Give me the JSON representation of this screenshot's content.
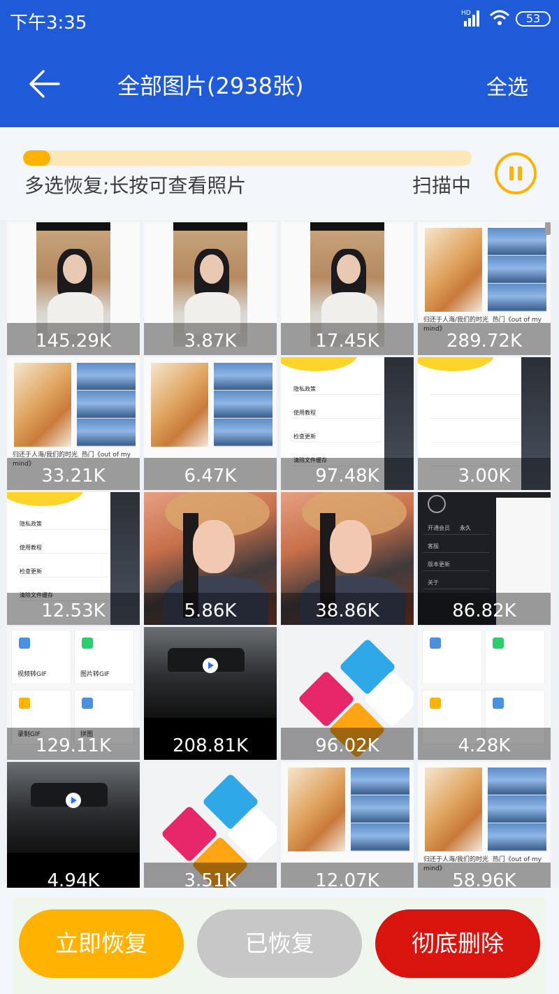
{
  "status_bar": {
    "time": "下午3:35",
    "network": "HD",
    "battery": "53"
  },
  "header": {
    "title": "全部图片(2938张)",
    "select_all": "全选"
  },
  "scan": {
    "progress_fraction": 0.06,
    "hint": "多选恢复;长按可查看照片",
    "status": "扫描中"
  },
  "thumbnails": [
    {
      "size": "145.29K",
      "kind": "portrait"
    },
    {
      "size": "3.87K",
      "kind": "portrait"
    },
    {
      "size": "17.45K",
      "kind": "portrait"
    },
    {
      "size": "289.72K",
      "kind": "collage",
      "caption_left": "归还于人海/我们的时光",
      "caption_right": "热门《out of my mind》"
    },
    {
      "size": "33.21K",
      "kind": "collage",
      "caption_left": "归还于人海/我们的时光",
      "caption_right": "热门《out of my mind》"
    },
    {
      "size": "6.47K",
      "kind": "collage",
      "caption_left": "",
      "caption_right": ""
    },
    {
      "size": "97.48K",
      "kind": "menu",
      "items": [
        "隐私政策",
        "使用教程",
        "检查更新",
        "清除文件缓存"
      ]
    },
    {
      "size": "3.00K",
      "kind": "menu",
      "items": [
        "",
        "",
        "",
        ""
      ]
    },
    {
      "size": "12.53K",
      "kind": "menu",
      "items": [
        "隐私政策",
        "使用教程",
        "检查更新",
        "清除文件缓存"
      ]
    },
    {
      "size": "5.86K",
      "kind": "face"
    },
    {
      "size": "38.86K",
      "kind": "face"
    },
    {
      "size": "86.82K",
      "kind": "dark",
      "rows": [
        "开通会员",
        "客服",
        "版本更新",
        "关于"
      ],
      "badge": "永久"
    },
    {
      "size": "129.11K",
      "kind": "feature",
      "labels": [
        "视频转GIF",
        "图片转GIF",
        "录制GIF",
        "拼图"
      ]
    },
    {
      "size": "208.81K",
      "kind": "video"
    },
    {
      "size": "96.02K",
      "kind": "diamond"
    },
    {
      "size": "4.28K",
      "kind": "feature",
      "labels": [
        "",
        "",
        "",
        ""
      ]
    },
    {
      "size": "4.94K",
      "kind": "video"
    },
    {
      "size": "3.51K",
      "kind": "diamond"
    },
    {
      "size": "12.07K",
      "kind": "collage",
      "caption_left": "",
      "caption_right": ""
    },
    {
      "size": "58.96K",
      "kind": "collage",
      "caption_left": "归还于人海/我们的时光",
      "caption_right": "热门《out of my mind》"
    }
  ],
  "actions": {
    "restore": "立即恢复",
    "restored": "已恢复",
    "delete": "彻底删除"
  },
  "colors": {
    "primary": "#1f5bd8",
    "accent": "#ffb300",
    "danger": "#d9140f",
    "disabled": "#c7c7c7"
  }
}
